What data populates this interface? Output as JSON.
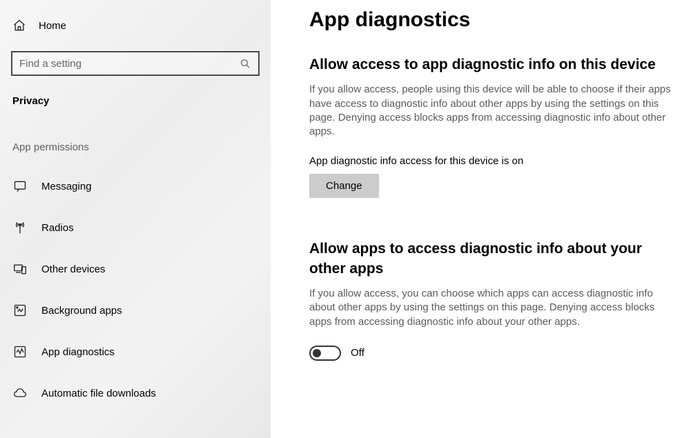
{
  "sidebar": {
    "home_label": "Home",
    "search_placeholder": "Find a setting",
    "category": "Privacy",
    "section_label": "App permissions",
    "items": [
      {
        "label": "Messaging"
      },
      {
        "label": "Radios"
      },
      {
        "label": "Other devices"
      },
      {
        "label": "Background apps"
      },
      {
        "label": "App diagnostics"
      },
      {
        "label": "Automatic file downloads"
      }
    ]
  },
  "main": {
    "page_title": "App diagnostics",
    "section1": {
      "title": "Allow access to app diagnostic info on this device",
      "desc": "If you allow access, people using this device will be able to choose if their apps have access to diagnostic info about other apps by using the settings on this page. Denying access blocks apps from accessing diagnostic info about other apps.",
      "status": "App diagnostic info access for this device is on",
      "change_label": "Change"
    },
    "section2": {
      "title": "Allow apps to access diagnostic info about your other apps",
      "desc": "If you allow access, you can choose which apps can access diagnostic info about other apps by using the settings on this page. Denying access blocks apps from accessing diagnostic info about your other apps.",
      "toggle_label": "Off"
    }
  }
}
